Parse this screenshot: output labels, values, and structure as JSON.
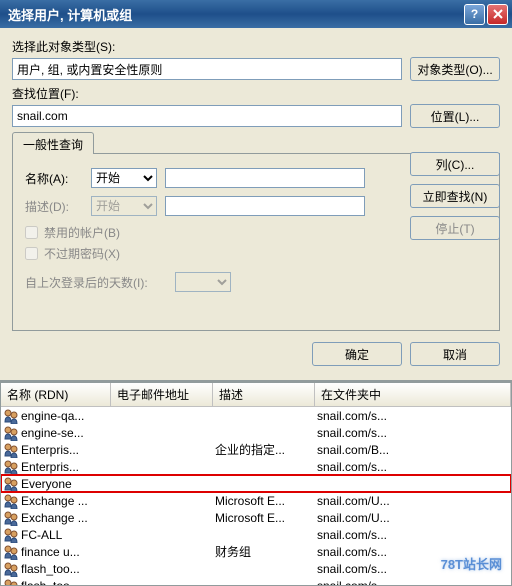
{
  "window": {
    "title": "选择用户, 计算机或组"
  },
  "object_type": {
    "label": "选择此对象类型(S):",
    "value": "用户, 组, 或内置安全性原则",
    "button": "对象类型(O)..."
  },
  "location": {
    "label": "查找位置(F):",
    "value": "snail.com",
    "button": "位置(L)..."
  },
  "tab": {
    "label": "一般性查询"
  },
  "query": {
    "name_label": "名称(A):",
    "name_mode": "开始",
    "desc_label": "描述(D):",
    "desc_mode": "开始",
    "disabled_accounts": "禁用的帐户(B)",
    "no_expire": "不过期密码(X)",
    "days_since_login": "自上次登录后的天数(I):"
  },
  "buttons": {
    "columns": "列(C)...",
    "find_now": "立即查找(N)",
    "stop": "停止(T)",
    "ok": "确定",
    "cancel": "取消"
  },
  "results": {
    "headers": {
      "name": "名称 (RDN)",
      "email": "电子邮件地址",
      "desc": "描述",
      "folder": "在文件夹中"
    },
    "rows": [
      {
        "name": "engine-qa...",
        "email": "",
        "desc": "",
        "folder": "snail.com/s..."
      },
      {
        "name": "engine-se...",
        "email": "",
        "desc": "",
        "folder": "snail.com/s..."
      },
      {
        "name": "Enterpris...",
        "email": "",
        "desc": "企业的指定...",
        "folder": "snail.com/B..."
      },
      {
        "name": "Enterpris...",
        "email": "",
        "desc": "",
        "folder": "snail.com/s..."
      },
      {
        "name": "Everyone",
        "email": "",
        "desc": "",
        "folder": "",
        "highlight": true
      },
      {
        "name": "Exchange ...",
        "email": "",
        "desc": "Microsoft E...",
        "folder": "snail.com/U..."
      },
      {
        "name": "Exchange ...",
        "email": "",
        "desc": "Microsoft E...",
        "folder": "snail.com/U..."
      },
      {
        "name": "FC-ALL",
        "email": "",
        "desc": "",
        "folder": "snail.com/s..."
      },
      {
        "name": "finance u...",
        "email": "",
        "desc": "财务组",
        "folder": "snail.com/s..."
      },
      {
        "name": "flash_too...",
        "email": "",
        "desc": "",
        "folder": "snail.com/s..."
      },
      {
        "name": "flash_too...",
        "email": "",
        "desc": "",
        "folder": "snail.com/s..."
      }
    ]
  },
  "watermark": "78T站长网"
}
